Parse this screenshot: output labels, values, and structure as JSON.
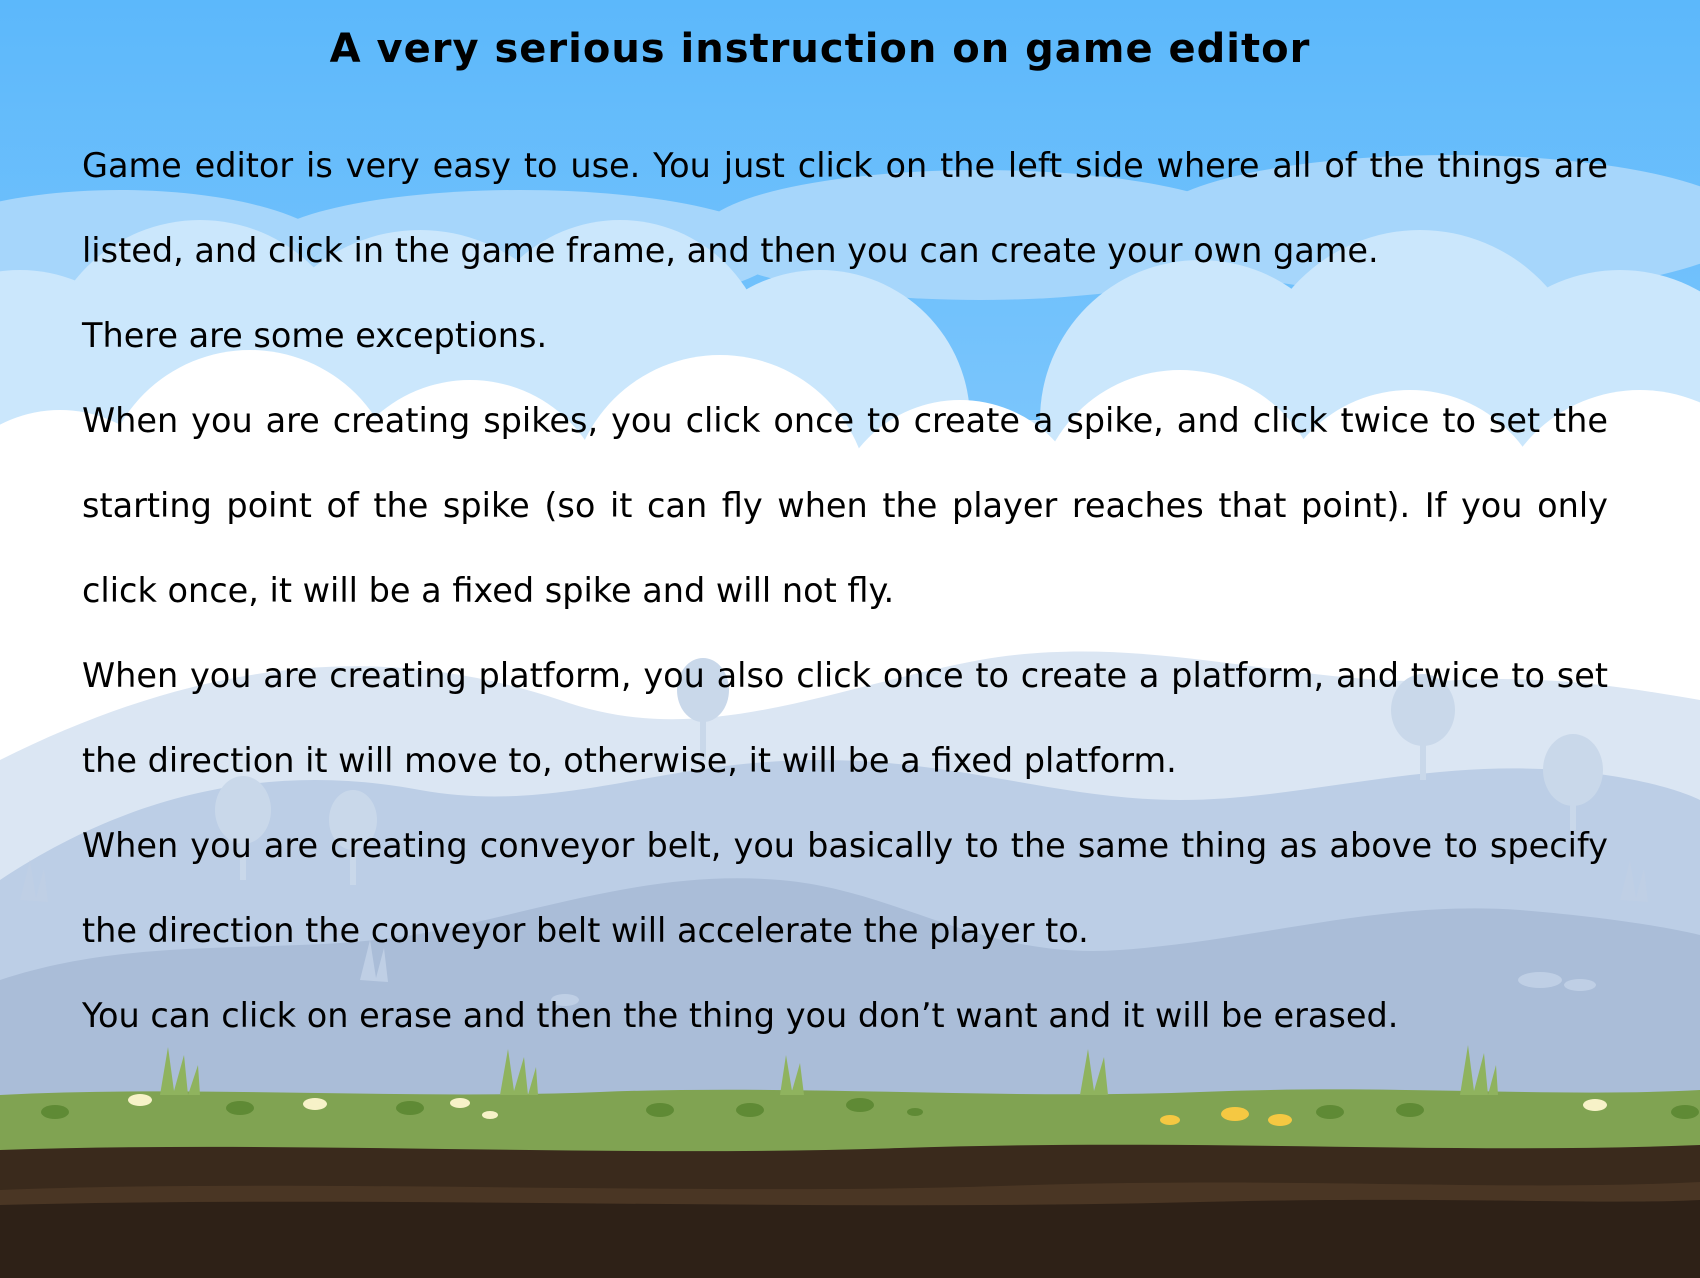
{
  "title": "A very serious instruction on game editor",
  "paragraphs": [
    "Game editor is very easy to use. You just click on the left side where all of the things are listed, and click in the game frame, and then you can create your own game.",
    "There are some exceptions.",
    "When you are creating spikes, you click once to create a spike, and click twice to set the starting point of the spike (so it can fly when the player reaches that point). If you only click once, it will be a fixed spike and will not fly.",
    "When you are creating platform, you also click once to create a platform, and twice to set the direction it will move to, otherwise, it will be a fixed platform.",
    "When you are creating conveyor belt, you basically to the same thing as above to specify the direction the conveyor belt will accelerate the player to.",
    "You can click on erase and then the thing you don’t want and it will be erased."
  ],
  "colors": {
    "sky_top": "#5cb8fb",
    "sky_mid": "#8fd0fd",
    "cloud_back": "#c9e6fb",
    "cloud_front": "#ffffff",
    "hill_back": "#d5e2f1",
    "hill_mid": "#b9cce4",
    "hill_front": "#a9bcd8",
    "grass": "#7ea150",
    "grass_dark": "#5f8a35",
    "soil_dark": "#2f2218",
    "soil_mid": "#3d2c1e"
  }
}
